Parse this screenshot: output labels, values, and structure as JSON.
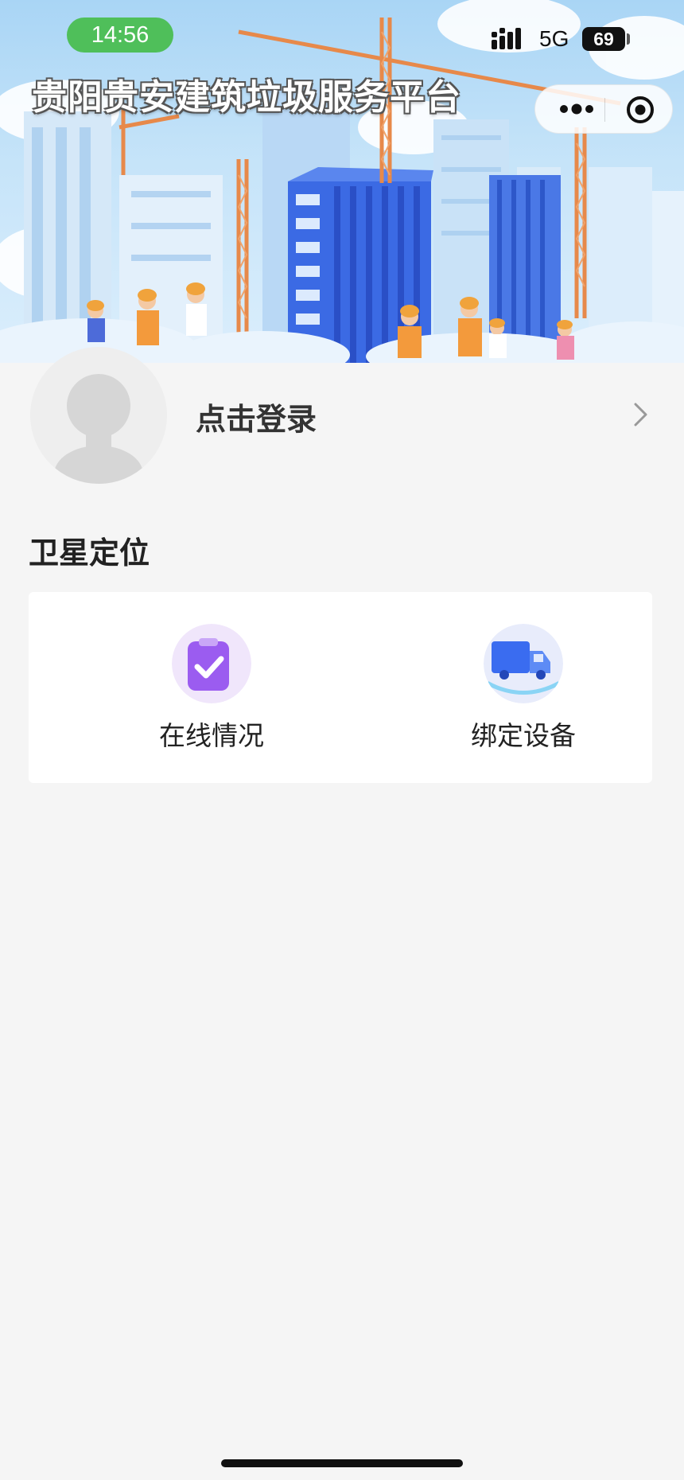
{
  "status_bar": {
    "time": "14:56",
    "network": "5G",
    "battery": "69"
  },
  "header": {
    "title": "贵阳贵安建筑垃圾服务平台",
    "more_icon": "more-dots-icon",
    "close_icon": "target-close-icon"
  },
  "profile": {
    "avatar_icon": "default-avatar-icon",
    "login_label": "点击登录",
    "arrow_icon": "chevron-right-icon"
  },
  "section": {
    "title": "卫星定位",
    "items": [
      {
        "label": "在线情况",
        "icon": "clipboard-check-icon",
        "color": "#9b5cf0"
      },
      {
        "label": "绑定设备",
        "icon": "truck-icon",
        "color": "#3a6cf0"
      }
    ]
  },
  "colors": {
    "status_time_bg": "#4fbf5a",
    "page_bg": "#f5f5f5",
    "banner_sky": "#a9d5f5",
    "crane": "#e7894a"
  }
}
